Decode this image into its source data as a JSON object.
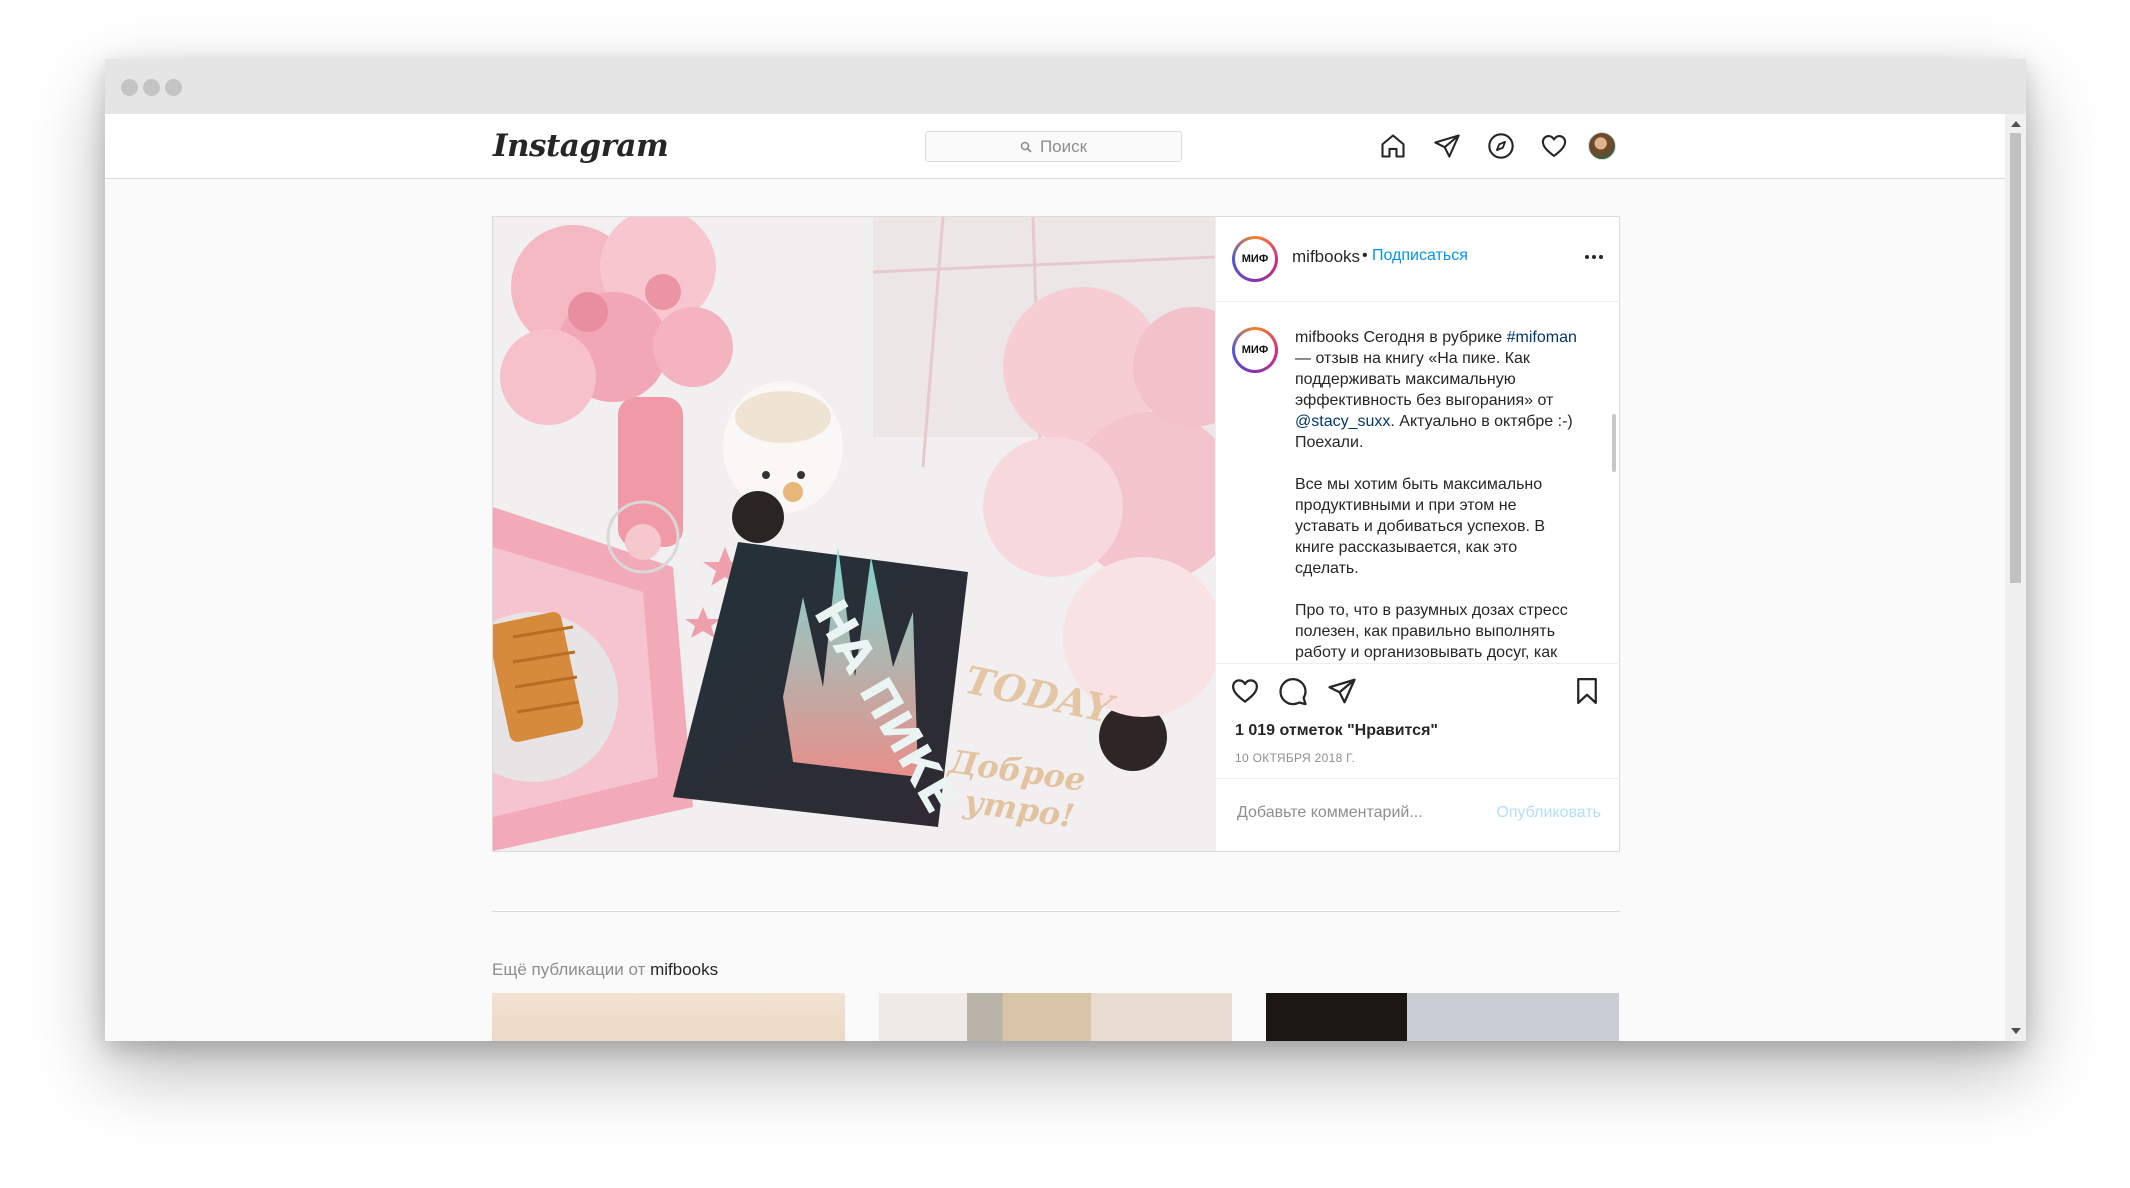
{
  "header": {
    "logo": "Instagram",
    "search_placeholder": "Поиск"
  },
  "post": {
    "username": "mifbooks",
    "avatar_text": "МИФ",
    "follow_separator": "•",
    "follow_label": "Подписаться",
    "caption": {
      "username": "mifbooks",
      "p1_text1": " Сегодня в рубрике ",
      "hashtag": "#mifoman",
      "p1_text2": " — отзыв на книгу «На пике. Как поддерживать максимальную эффективность без выгорания» от ",
      "mention": "@stacy_suxx",
      "p1_text3": ". Актуально в октябре :-) Поехали.",
      "p2": "Все мы хотим быть максимально продуктивными и при этом не уставать и добиваться успехов. В книге рассказывается, как это сделать.",
      "p3": "Про то, что в разумных дозах стресс полезен, как правильно выполнять работу и организовывать досуг, как"
    },
    "likes": "1 019 отметок \"Нравится\"",
    "date": "10 ОКТЯБРЯ 2018 Г.",
    "comment_placeholder": "Добавьте комментарий...",
    "publish_label": "Опубликовать",
    "photo": {
      "book_title": "НА ПИКЕ",
      "sign_today": "TODAY",
      "sign_morning_1": "Доброе",
      "sign_morning_2": "утро!"
    }
  },
  "more": {
    "prefix": "Ещё публикации от ",
    "username": "mifbooks"
  },
  "colors": {
    "link_blue": "#0095f6",
    "publish_disabled": "#b2dffc",
    "hashtag": "#00376b"
  }
}
